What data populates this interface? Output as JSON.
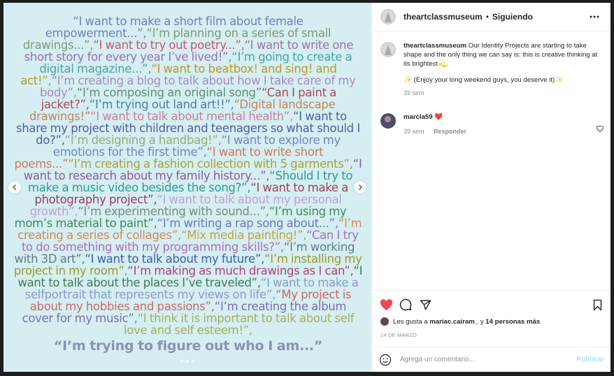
{
  "poster": {
    "phrases": [
      {
        "text": "“I want to make a short film about female empowerment...”,",
        "color": "#6e7fc4"
      },
      {
        "text": "“I’m planning on a series of small drawings...”,",
        "color": "#7f9a78"
      },
      {
        "text": "“I want to try out poetry...”,",
        "color": "#c8566a"
      },
      {
        "text": "“I want to write one short story for every year I’ve lived!”,",
        "color": "#9b6fb0"
      },
      {
        "text": "“I’m going to create a digital magazine...”,",
        "color": "#4aa3a3"
      },
      {
        "text": "“I want to beatbox! and sing! and act!”,",
        "color": "#b59a2c"
      },
      {
        "text": "“I’m creating a blog to talk about how I take care of my body”,",
        "color": "#a88ac8"
      },
      {
        "text": "“I’m composing an original song”",
        "color": "#5e8f6e"
      },
      {
        "text": "“Can I paint a jacket?”,",
        "color": "#b0455a"
      },
      {
        "text": "“I’m trying out land art!!”,",
        "color": "#4f7db0"
      },
      {
        "text": "“Digital landscape drawings!”",
        "color": "#c08660"
      },
      {
        "text": "“I want to talk about mental health”,",
        "color": "#c77ea0"
      },
      {
        "text": "“I want to share my project with children and teenagers so what should I do?”,",
        "color": "#4d5fa3"
      },
      {
        "text": "“I’m designing a handbag!”,",
        "color": "#8fae7c"
      },
      {
        "text": "“I want to explore my emotions for the first time”,",
        "color": "#6f86c9"
      },
      {
        "text": "“I want to write short poems...”",
        "color": "#d2785a"
      },
      {
        "text": "“I’m creating a fashion collection with 5 garments”,",
        "color": "#a5a23c"
      },
      {
        "text": "“I want to research about my family history...”,",
        "color": "#8a5aa6"
      },
      {
        "text": "“Should I try to make a music video besides the song?”,",
        "color": "#2e9a9a"
      },
      {
        "text": "“I want to make a photography project”,",
        "color": "#9a3d5e"
      },
      {
        "text": "“I want to talk about my personal growth”,",
        "color": "#c29fd4"
      },
      {
        "text": "“I’m experimenting with sound...”,",
        "color": "#6f8f7c"
      },
      {
        "text": "“I’m using my mom’s material to paint”,",
        "color": "#3d8a5a"
      },
      {
        "text": "“I’m writing a rap song about...”,",
        "color": "#6b78bf"
      },
      {
        "text": "“I’m creating a series of collages”,",
        "color": "#d08a5a"
      },
      {
        "text": "“Mix media painting!”,",
        "color": "#c4a24a"
      },
      {
        "text": "“Can I try to do something with my programming skills?”,",
        "color": "#a86fc0"
      },
      {
        "text": "“I’m working with 3D art”,",
        "color": "#5f7d8c"
      },
      {
        "text": "“I want to talk about my future”,",
        "color": "#3a5fb5"
      },
      {
        "text": "“I’m installing my project in my room”,",
        "color": "#9a9a2e"
      },
      {
        "text": "“I’m making as much drawings as I can”,",
        "color": "#b0407a"
      },
      {
        "text": "“I want to talk about the places I’ve traveled”,",
        "color": "#3f7a55"
      },
      {
        "text": "“I want to make a selfportrait that represents my views on life”,",
        "color": "#8a9ad0"
      },
      {
        "text": "“My project is about my hobbies and passions”,",
        "color": "#c76a6a"
      },
      {
        "text": "“I’m creating the album cover for my music”,",
        "color": "#7a6fb5"
      },
      {
        "text": "“I think it is important to talk about self love and self esteem!”,",
        "color": "#a3b05a"
      }
    ],
    "final_phrase": "“I’m trying to figure out who I am...”",
    "final_color": "#8a93b0",
    "background": "#d5eef1"
  },
  "header": {
    "username": "theartclassmuseum",
    "separator": "•",
    "follow_status": "Siguiendo"
  },
  "caption": {
    "username": "theartclassmuseum",
    "text": "Our Identity Projects are starting to take shape and the only thing we can say is: this is creative thinking at its brightest💫.",
    "second_line": "✨ (Enjoy your long weekend guys, you deserve it)✨",
    "time": "39 sem"
  },
  "comment": {
    "username": "marcla59",
    "text": "❤️",
    "time": "39 sem",
    "reply_label": "Responder"
  },
  "likes": {
    "prefix": "Les gusta a",
    "user": "mariac.cairam_",
    "middle": "y",
    "others": "14 personas más"
  },
  "date": "14 DE MARZO",
  "add_comment": {
    "placeholder": "Agrega un comentario...",
    "post_label": "Publicar"
  },
  "icons": {
    "like": "heart-filled-icon",
    "comment": "comment-icon",
    "share": "share-icon",
    "save": "bookmark-icon",
    "emoji": "emoji-icon",
    "more": "more-icon"
  },
  "colors": {
    "like_red": "#ed4956",
    "post_blue": "#b2dffc",
    "secondary_text": "#8e8e8e"
  }
}
